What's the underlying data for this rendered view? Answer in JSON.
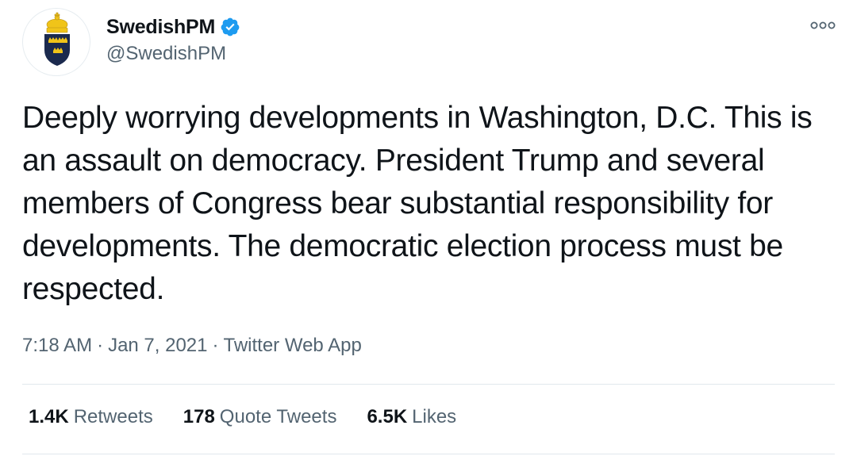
{
  "author": {
    "display_name": "SwedishPM",
    "handle": "@SwedishPM",
    "verified": true,
    "avatar_icon": "swedish-government-crest-icon",
    "verified_icon": "verified-badge-icon",
    "verified_color": "#1d9bf0"
  },
  "tweet": {
    "text": "Deeply worrying developments in Washington, D.C. This is an assault on democracy. President Trump and several members of Congress bear substantial responsibility for developments. The democratic election process must be respected."
  },
  "meta": {
    "time": "7:18 AM",
    "separator": "·",
    "date": "Jan 7, 2021",
    "source": "Twitter Web App"
  },
  "stats": {
    "retweets": {
      "count": "1.4K",
      "label": "Retweets"
    },
    "quote_tweets": {
      "count": "178",
      "label": "Quote Tweets"
    },
    "likes": {
      "count": "6.5K",
      "label": "Likes"
    }
  },
  "menu": {
    "icon": "more-options-icon"
  },
  "colors": {
    "text_primary": "#0f1419",
    "text_secondary": "#536471",
    "divider": "#e1e8ed",
    "crest_blue": "#1b2a4e",
    "crest_gold": "#f0c419"
  }
}
